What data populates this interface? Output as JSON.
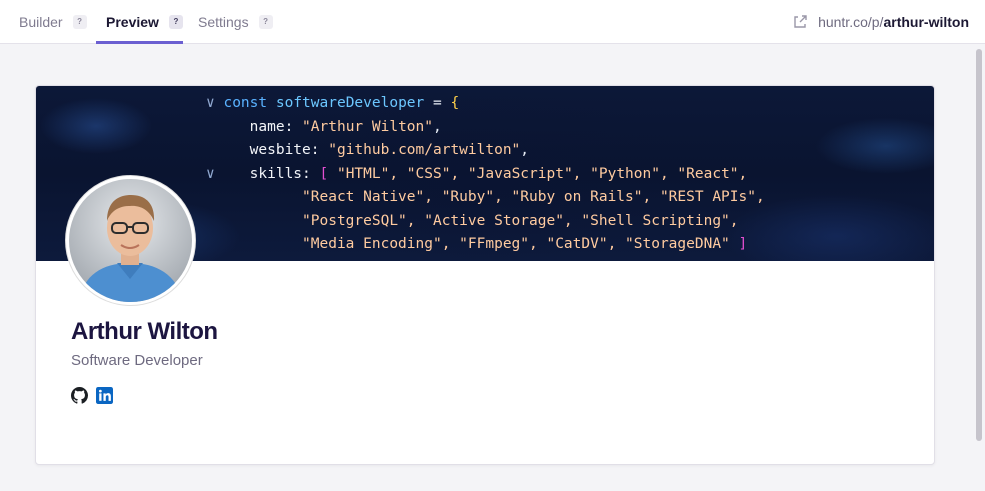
{
  "tabs": [
    {
      "label": "Builder",
      "help": "?"
    },
    {
      "label": "Preview",
      "help": "?"
    },
    {
      "label": "Settings",
      "help": "?"
    }
  ],
  "share": {
    "prefix": "huntr.co/p/",
    "slug": "arthur-wilton",
    "icon": "external-link-icon"
  },
  "profile": {
    "name": "Arthur Wilton",
    "title": "Software Developer",
    "social_icons": [
      "github-icon",
      "linkedin-icon"
    ]
  },
  "banner_code": {
    "line1": {
      "chev": "∨",
      "kw": "const",
      "var": "softwareDeveloper",
      "eq": " = ",
      "brace": "{"
    },
    "line2": {
      "prop": "name:",
      "str": "\"Arthur Wilton\"",
      "tail": ","
    },
    "line3": {
      "prop": "wesbite:",
      "str": "\"github.com/artwilton\"",
      "tail": ","
    },
    "line4": {
      "chev": "∨",
      "prop": "skills:",
      "bracket": "[",
      "items": "\"HTML\", \"CSS\", \"JavaScript\", \"Python\", \"React\","
    },
    "line5": "\"React Native\", \"Ruby\", \"Ruby on Rails\", \"REST APIs\",",
    "line6": "\"PostgreSQL\", \"Active Storage\", \"Shell Scripting\",",
    "line7": {
      "items": "\"Media Encoding\", \"FFmpeg\", \"CatDV\", \"StorageDNA\"",
      "bracket": "]"
    },
    "line8": "};"
  },
  "colors": {
    "accent": "#6b5fd1",
    "name": "#1c1540",
    "linkedin": "#0a66c2"
  }
}
